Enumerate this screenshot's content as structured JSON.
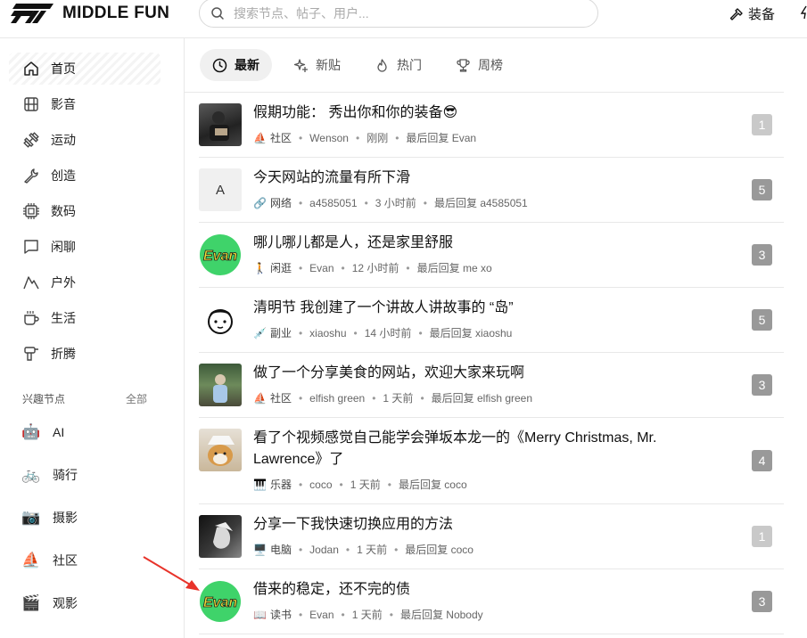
{
  "header": {
    "logo_text": "MIDDLE FUN",
    "search_placeholder": "搜索节点、帖子、用户...",
    "gear_label": "装备"
  },
  "sidebar": {
    "nav": [
      {
        "label": "首页",
        "icon": "home-icon"
      },
      {
        "label": "影音",
        "icon": "film-icon"
      },
      {
        "label": "运动",
        "icon": "dumbbell-icon"
      },
      {
        "label": "创造",
        "icon": "wrench-icon"
      },
      {
        "label": "数码",
        "icon": "chip-icon"
      },
      {
        "label": "闲聊",
        "icon": "chat-icon"
      },
      {
        "label": "户外",
        "icon": "mountain-icon"
      },
      {
        "label": "生活",
        "icon": "cup-icon"
      },
      {
        "label": "折腾",
        "icon": "drill-icon"
      }
    ],
    "section_title": "兴趣节点",
    "section_all": "全部",
    "nodes": [
      {
        "label": "AI",
        "emoji": "🤖"
      },
      {
        "label": "骑行",
        "emoji": "🚲"
      },
      {
        "label": "摄影",
        "emoji": "📷"
      },
      {
        "label": "社区",
        "emoji": "⛵"
      },
      {
        "label": "观影",
        "emoji": "🎬"
      }
    ]
  },
  "tabs": [
    {
      "label": "最新",
      "icon": "clock-icon"
    },
    {
      "label": "新贴",
      "icon": "sparkle-icon"
    },
    {
      "label": "热门",
      "icon": "flame-icon"
    },
    {
      "label": "周榜",
      "icon": "trophy-icon"
    }
  ],
  "topics": [
    {
      "title": "假期功能： 秀出你和你的装备😎",
      "node_emoji": "⛵",
      "node": "社区",
      "author": "Wenson",
      "time": "刚刚",
      "last_reply": "最后回复 Evan",
      "count": "1"
    },
    {
      "title": "今天网站的流量有所下滑",
      "node_emoji": "🔗",
      "node": "网络",
      "author": "a4585051",
      "time": "3 小时前",
      "last_reply": "最后回复 a4585051",
      "count": "5",
      "avatar_letter": "A"
    },
    {
      "title": "哪儿哪儿都是人，还是家里舒服",
      "node_emoji": "🚶",
      "node": "闲逛",
      "author": "Evan",
      "time": "12 小时前",
      "last_reply": "最后回复 me xo",
      "count": "3",
      "avatar_text": "Evan"
    },
    {
      "title": "清明节 我创建了一个讲故人讲故事的 “岛”",
      "node_emoji": "💉",
      "node": "副业",
      "author": "xiaoshu",
      "time": "14 小时前",
      "last_reply": "最后回复 xiaoshu",
      "count": "5"
    },
    {
      "title": "做了一个分享美食的网站，欢迎大家来玩啊",
      "node_emoji": "⛵",
      "node": "社区",
      "author": "elfish green",
      "time": "1 天前",
      "last_reply": "最后回复 elfish green",
      "count": "3"
    },
    {
      "title": "看了个视频感觉自己能学会弹坂本龙一的《Merry Christmas, Mr. Lawrence》了",
      "node_emoji": "🎹",
      "node": "乐器",
      "author": "coco",
      "time": "1 天前",
      "last_reply": "最后回复 coco",
      "count": "4"
    },
    {
      "title": "分享一下我快速切换应用的方法",
      "node_emoji": "🖥️",
      "node": "电脑",
      "author": "Jodan",
      "time": "1 天前",
      "last_reply": "最后回复 coco",
      "count": "1"
    },
    {
      "title": "借来的稳定，还不完的债",
      "node_emoji": "📖",
      "node": "读书",
      "author": "Evan",
      "time": "1 天前",
      "last_reply": "最后回复 Nobody",
      "count": "3",
      "avatar_text": "Evan"
    }
  ],
  "colors": {
    "count_badge": "#999999",
    "count_badge_light": "#c9c9c9",
    "arrow": "#e8332a",
    "evan_green": "#3fd36a",
    "evan_yellow": "#f5e13a"
  }
}
